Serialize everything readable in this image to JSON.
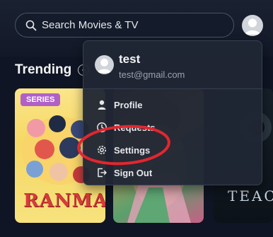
{
  "search": {
    "placeholder": "Search Movies & TV"
  },
  "section": {
    "title": "Trending"
  },
  "cards": [
    {
      "badge": "SERIES",
      "logo_text": "RANMA½"
    },
    {},
    {
      "title_fragment": "TEAC"
    }
  ],
  "user_menu": {
    "name": "test",
    "email": "test@gmail.com",
    "items": [
      {
        "label": "Profile",
        "icon": "person-icon"
      },
      {
        "label": "Requests",
        "icon": "clock-icon"
      },
      {
        "label": "Settings",
        "icon": "gear-icon"
      },
      {
        "label": "Sign Out",
        "icon": "sign-out-icon"
      }
    ]
  },
  "annotation": {
    "color": "#e3262e",
    "target": "Settings"
  }
}
